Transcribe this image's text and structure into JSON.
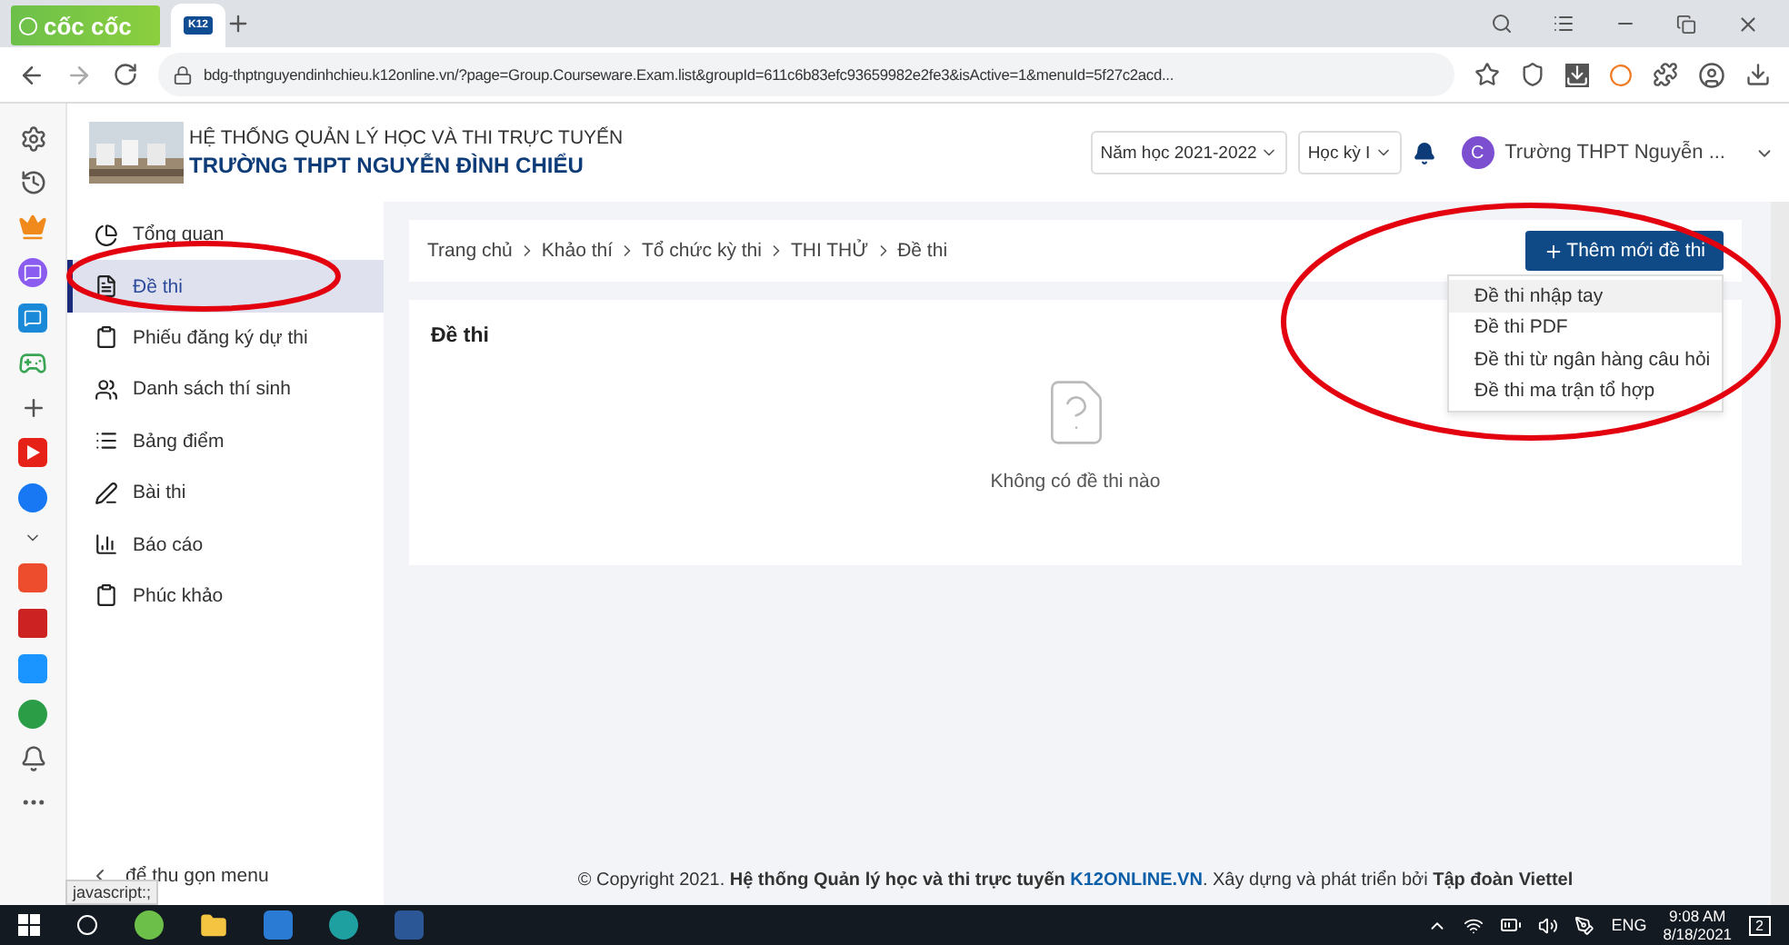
{
  "browser": {
    "brand": "cốc cốc",
    "tabs": [
      {
        "favicon": "K12",
        "selected": true
      }
    ],
    "url": "bdg-thptnguyendinhchieu.k12online.vn/?page=Group.Courseware.Exam.list&groupId=611c6b83efc93659982e2fe3&isActive=1&menuId=5f27c2acd..."
  },
  "header": {
    "system": "HỆ THỐNG QUẢN LÝ HỌC VÀ THI TRỰC TUYẾN",
    "school": "TRƯỜNG THPT NGUYỄN ĐÌNH CHIỂU",
    "year": "Năm học 2021-2022",
    "term": "Học kỳ I",
    "avatar": "C",
    "user": "Trường THPT Nguyễn ..."
  },
  "menu": {
    "items": [
      {
        "kind": "pie",
        "label": "Tổng quan",
        "selected": false
      },
      {
        "kind": "file",
        "label": "Đề thi",
        "selected": true
      },
      {
        "kind": "form",
        "label": "Phiếu đăng ký dự thi",
        "selected": false
      },
      {
        "kind": "users",
        "label": "Danh sách thí sinh",
        "selected": false
      },
      {
        "kind": "list",
        "label": "Bảng điểm",
        "selected": false
      },
      {
        "kind": "edit",
        "label": "Bài thi",
        "selected": false
      },
      {
        "kind": "chart",
        "label": "Báo cáo",
        "selected": false
      },
      {
        "kind": "clipboard",
        "label": "Phúc khảo",
        "selected": false
      }
    ],
    "collapse": "để thu gọn menu",
    "tooltip": "javascript:;"
  },
  "breadcrumb": [
    "Trang chủ",
    "Khảo thí",
    "Tổ chức kỳ thi",
    "THI THỬ",
    "Đề thi"
  ],
  "add_button": "Thêm mới đề thi",
  "add_menu": [
    {
      "label": "Đề thi nhập tay",
      "selected": true
    },
    {
      "label": "Đề thi PDF",
      "selected": false
    },
    {
      "label": "Đề thi từ ngân hàng câu hỏi",
      "selected": false
    },
    {
      "label": "Đề thi ma trận tổ hợp",
      "selected": false
    }
  ],
  "card": {
    "title": "Đề thi",
    "empty": "Không có đề thi nào"
  },
  "footer": {
    "before": "© Copyright 2021. **Hệ thống Quản lý học và thi trực tuyến**",
    "link": "K12ONLINE.VN",
    "after": ". Xây dựng và phát triển bởi **Tập đoàn Viettel**"
  },
  "annotations": [
    {
      "kind": "ellipse"
    },
    {
      "kind": "ellipse"
    }
  ],
  "taskbar": {
    "language": "ENG",
    "time": "9:08 AM",
    "date": "8/18/2021",
    "notifications": "2"
  }
}
